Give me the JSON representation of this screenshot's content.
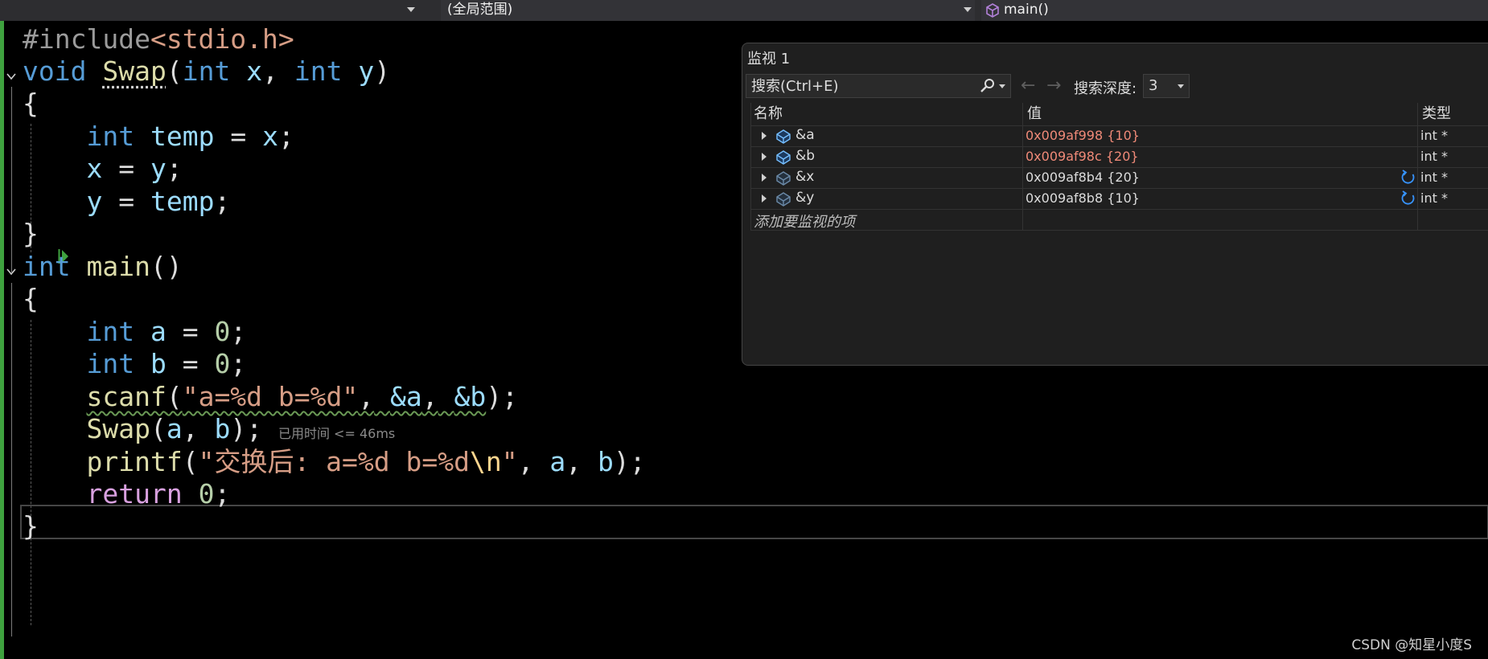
{
  "navbar": {
    "scope": "(全局范围)",
    "function": "main()"
  },
  "editor": {
    "perf_tip": "已用时间 <= 46ms",
    "lines": {
      "l1": [
        "#include",
        "<stdio.h>"
      ],
      "l2": [
        "void",
        "Swap",
        "(",
        "int",
        "x",
        ",",
        "int",
        "y",
        ")"
      ],
      "l3": "{",
      "l4": [
        "int",
        "temp",
        "=",
        "x",
        ";"
      ],
      "l5": [
        "x",
        "=",
        "y",
        ";"
      ],
      "l6": [
        "y",
        "=",
        "temp",
        ";"
      ],
      "l7": "}",
      "l8": [
        "int",
        "main",
        "()"
      ],
      "l9": "{",
      "l10": [
        "int",
        "a",
        "=",
        "0",
        ";"
      ],
      "l11": [
        "int",
        "b",
        "=",
        "0",
        ";"
      ],
      "l12": [
        "scanf",
        "(",
        "\"a=%d b=%d\"",
        ",",
        "&a",
        ",",
        "&b",
        ");"
      ],
      "l13": [
        "Swap",
        "(",
        "a",
        ",",
        "b",
        ");"
      ],
      "l14": [
        "printf",
        "(",
        "\"交换后: a=%d b=%d",
        "\\n",
        "\"",
        ",",
        "a",
        ",",
        "b",
        ");"
      ],
      "l15": [
        "return",
        "0",
        ";"
      ],
      "l16": "}"
    }
  },
  "watch": {
    "title": "监视 1",
    "search_placeholder": "搜索(Ctrl+E)",
    "back_arrow": "←",
    "forward_arrow": "→",
    "depth_label": "搜索深度:",
    "depth_value": "3",
    "columns": {
      "name": "名称",
      "value": "值",
      "type": "类型"
    },
    "rows": [
      {
        "name": "&a",
        "value": "0x009af998 {10}",
        "type": "int *",
        "changed": true
      },
      {
        "name": "&b",
        "value": "0x009af98c {20}",
        "type": "int *",
        "changed": true
      },
      {
        "name": "&x",
        "value": "0x009af8b4 {20}",
        "type": "int *",
        "changed": false
      },
      {
        "name": "&y",
        "value": "0x009af8b8 {10}",
        "type": "int *",
        "changed": false
      }
    ],
    "add_item": "添加要监视的项"
  },
  "watermark": "CSDN @知星小度S",
  "colors": {
    "keyword": "#569cd6",
    "function": "#dcdcaa",
    "variable": "#9cdcfe",
    "string": "#d69d85",
    "number": "#b5cea8",
    "changed_value": "#f08a78",
    "change_bar": "#3fa23f"
  },
  "icons": {
    "nav_func": "cube-icon",
    "search": "search-icon",
    "row_object": "object-icon",
    "refresh": "refresh-icon",
    "step": "current-statement-arrow-icon"
  }
}
